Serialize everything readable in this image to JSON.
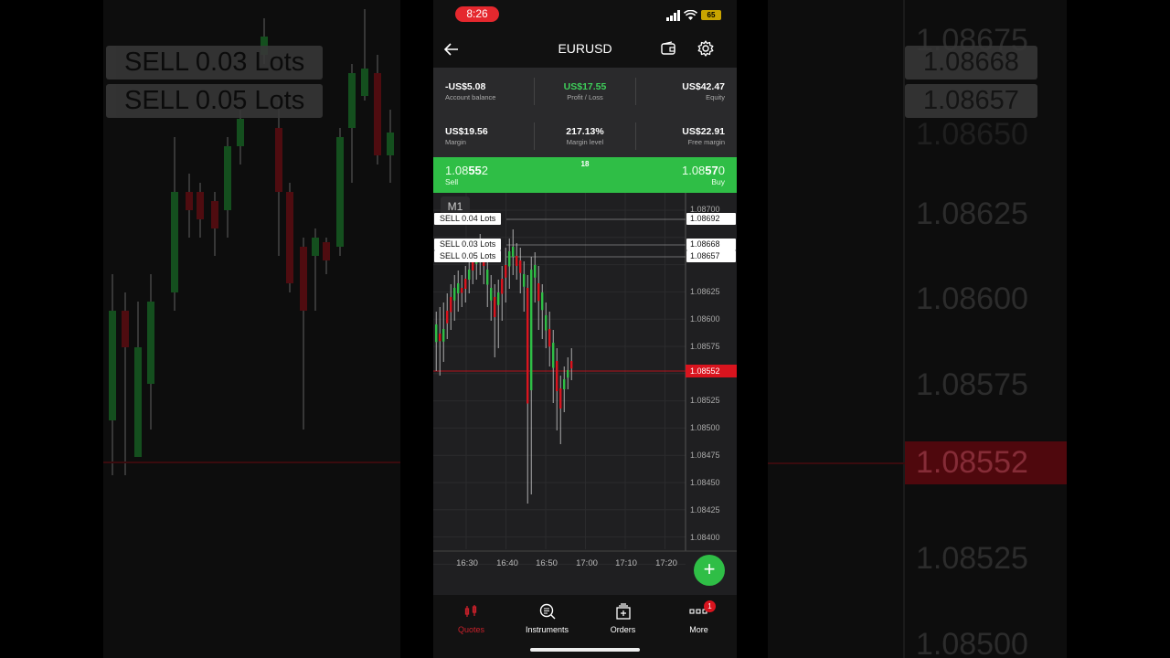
{
  "status": {
    "time": "8:26",
    "battery": "65"
  },
  "header": {
    "title": "EURUSD"
  },
  "account": {
    "balance": {
      "value": "-US$5.08",
      "label": "Account balance"
    },
    "profit": {
      "value": "US$17.55",
      "label": "Profit / Loss"
    },
    "equity": {
      "value": "US$42.47",
      "label": "Equity"
    },
    "margin": {
      "value": "US$19.56",
      "label": "Margin"
    },
    "margin_level": {
      "value": "217.13%",
      "label": "Margin level"
    },
    "free_margin": {
      "value": "US$22.91",
      "label": "Free margin"
    }
  },
  "quote": {
    "sell_pre": "1.08",
    "sell_big": "55",
    "sell_post": "2",
    "sell_label": "Sell",
    "buy_pre": "1.08",
    "buy_big": "57",
    "buy_post": "0",
    "buy_label": "Buy",
    "spread": "18"
  },
  "chart": {
    "timeframe": "M1",
    "orders": [
      {
        "label": "SELL 0.04 Lots",
        "price": "1.08692"
      },
      {
        "label": "SELL 0.03 Lots",
        "price": "1.08668"
      },
      {
        "label": "SELL 0.05 Lots",
        "price": "1.08657"
      }
    ],
    "current_price": "1.08552",
    "y_ticks": [
      "1.08700",
      "1.08675",
      "1.08650",
      "1.08625",
      "1.08600",
      "1.08575",
      "1.08550",
      "1.08525",
      "1.08500",
      "1.08475",
      "1.08450",
      "1.08425",
      "1.08400"
    ],
    "x_ticks": [
      "16:30",
      "16:40",
      "16:50",
      "17:00",
      "17:10",
      "17:20"
    ],
    "fab": "+"
  },
  "tabs": [
    {
      "label": "Quotes"
    },
    {
      "label": "Instruments"
    },
    {
      "label": "Orders"
    },
    {
      "label": "More",
      "badge": "1"
    }
  ],
  "blur_left": {
    "tags": [
      "SELL 0.03 Lots",
      "SELL 0.05 Lots"
    ]
  },
  "blur_right": {
    "prices": [
      "1.08675",
      "1.08668",
      "1.08657",
      "1.08650",
      "1.08625",
      "1.08600",
      "1.08575",
      "1.08552",
      "1.08525",
      "1.08500"
    ]
  },
  "colors": {
    "buy_green": "#2fbe46",
    "sell_red": "#d9141e",
    "profit_green": "#3ecf5a"
  }
}
